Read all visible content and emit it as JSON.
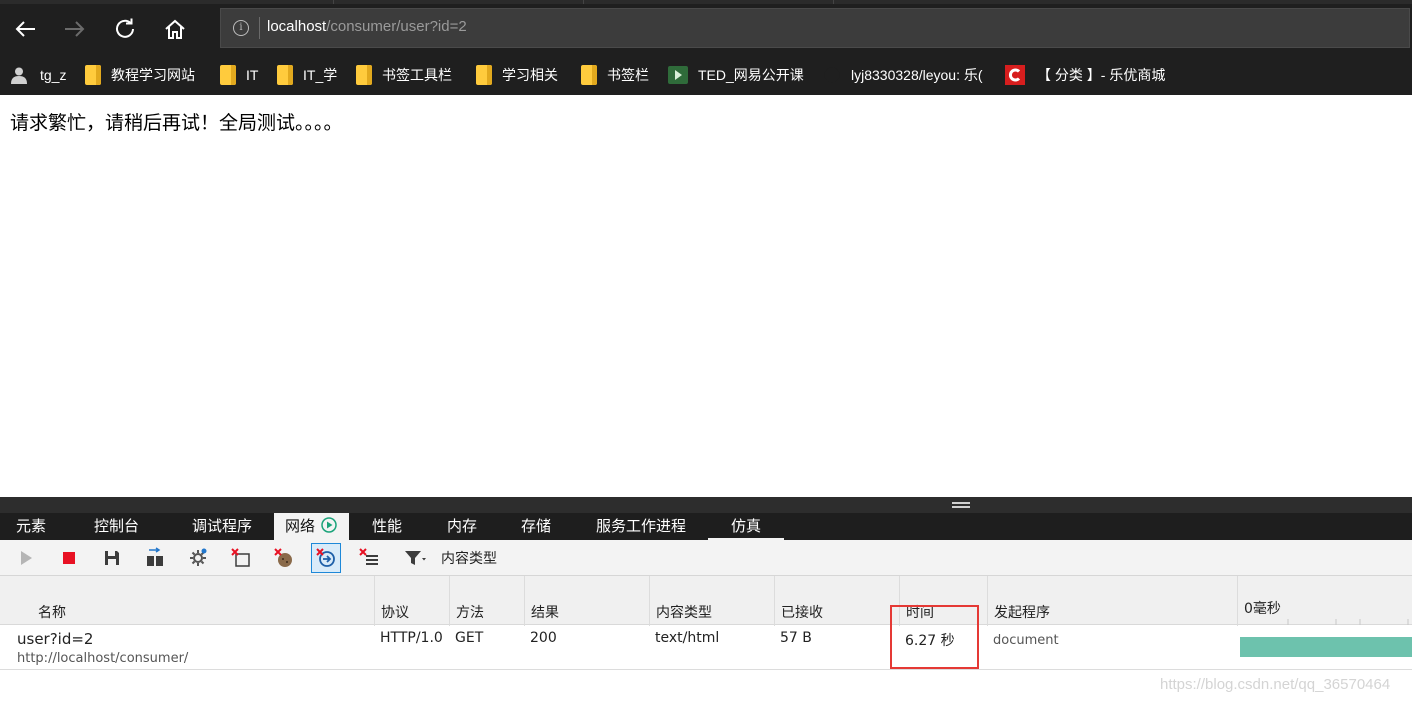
{
  "browser": {
    "address": {
      "host": "localhost",
      "path": "/consumer/user?id=2"
    },
    "favorites": [
      {
        "label": "tg_z",
        "icon": "person-icon"
      },
      {
        "label": "教程学习网站",
        "icon": "folder-icon"
      },
      {
        "label": "IT",
        "icon": "folder-icon"
      },
      {
        "label": "IT_学",
        "icon": "folder-icon"
      },
      {
        "label": "书签工具栏",
        "icon": "folder-icon"
      },
      {
        "label": "学习相关",
        "icon": "folder-icon"
      },
      {
        "label": "书签栏",
        "icon": "folder-icon"
      },
      {
        "label": "TED_网易公开课",
        "icon": "play-icon"
      },
      {
        "label": "lyj8330328/leyou: 乐(",
        "icon": "github-icon"
      },
      {
        "label": "【 分类 】- 乐优商城",
        "icon": "csdn-icon"
      }
    ]
  },
  "page": {
    "message": "请求繁忙，请稍后再试！全局测试。。。。"
  },
  "devtools": {
    "tabs": [
      "元素",
      "控制台",
      "调试程序",
      "网络",
      "性能",
      "内存",
      "存储",
      "服务工作进程",
      "仿真"
    ],
    "active_tab": "网络",
    "toolbar": {
      "filter_label": "内容类型"
    },
    "network": {
      "columns": [
        "名称",
        "协议",
        "方法",
        "结果",
        "内容类型",
        "已接收",
        "时间",
        "发起程序"
      ],
      "timeline_label": "0毫秒",
      "rows": [
        {
          "name": "user?id=2",
          "url": "http://localhost/consumer/",
          "protocol": "HTTP/1.0",
          "method": "GET",
          "result": "200",
          "content_type": "text/html",
          "received": "57 B",
          "time": "6.27 秒",
          "initiator": "document"
        }
      ]
    }
  },
  "watermark": "https://blog.csdn.net/qq_36570464",
  "colors": {
    "highlight": "#e53935",
    "waterfall": "#6dc2ad",
    "chrome": "#1f1f1f"
  }
}
